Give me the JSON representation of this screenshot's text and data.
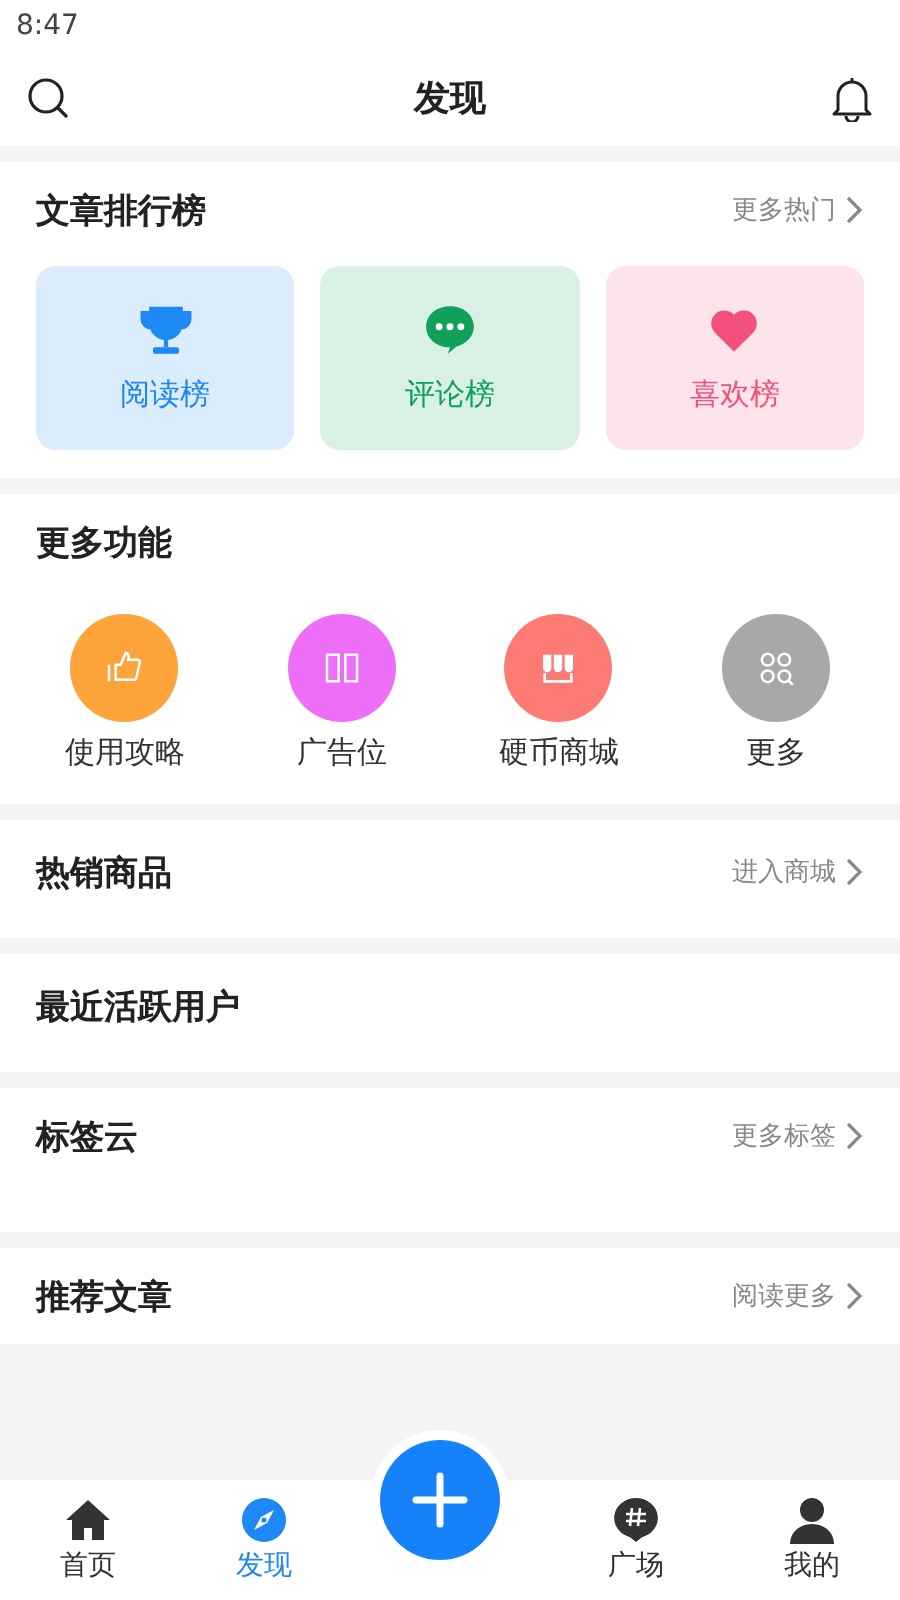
{
  "status_bar": {
    "time": "8:47"
  },
  "header": {
    "title": "发现"
  },
  "sections": [
    {
      "kind": "cards",
      "title": "文章排行榜",
      "more": "更多热门",
      "cards": [
        {
          "label": "阅读榜",
          "color": "#1e88f5"
        },
        {
          "label": "评论榜",
          "color": "#11a05a"
        },
        {
          "label": "喜欢榜",
          "color": "#f4507c"
        }
      ]
    },
    {
      "kind": "grid",
      "title": "更多功能",
      "items": [
        {
          "label": "使用攻略",
          "color": "#fca43a"
        },
        {
          "label": "广告位",
          "color": "#ee6ff7"
        },
        {
          "label": "硬币商城",
          "color": "#fd7b75"
        },
        {
          "label": "更多",
          "color": "#a8a8a8"
        }
      ]
    },
    {
      "kind": "plain",
      "title": "热销商品",
      "more": "进入商城"
    },
    {
      "kind": "plain",
      "title": "最近活跃用户"
    },
    {
      "kind": "tall",
      "title": "标签云",
      "more": "更多标签"
    },
    {
      "kind": "short",
      "title": "推荐文章",
      "more": "阅读更多"
    }
  ],
  "nav": [
    {
      "kind": "tab",
      "label": "首页",
      "selected": false
    },
    {
      "kind": "tab",
      "label": "发现",
      "selected": true
    },
    {
      "kind": "add"
    },
    {
      "kind": "tab",
      "label": "广场",
      "selected": false
    },
    {
      "kind": "tab",
      "label": "我的",
      "selected": false
    }
  ]
}
